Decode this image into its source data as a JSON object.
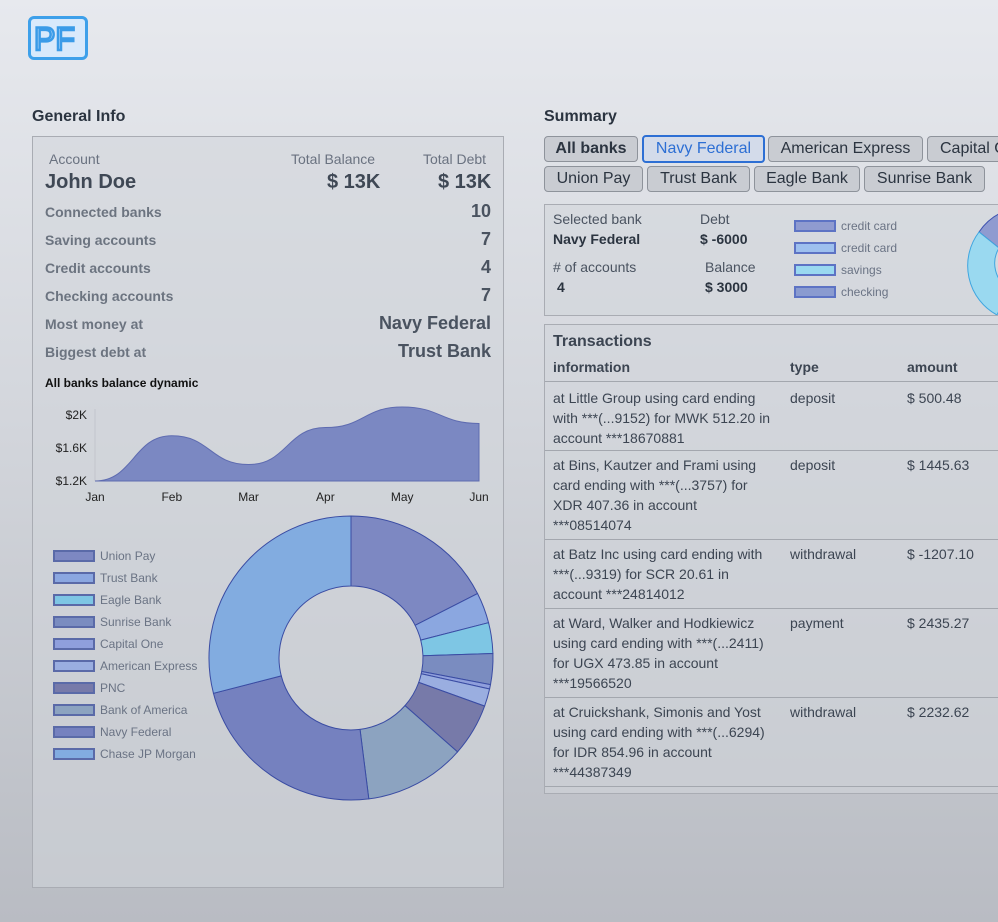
{
  "logo": {
    "text": "PF"
  },
  "general_info": {
    "title": "General Info",
    "account_header": "Account",
    "total_balance_header": "Total Balance",
    "total_debt_header": "Total Debt",
    "account_name": "John Doe",
    "total_balance": "$ 13K",
    "total_debt": "$ 13K",
    "rows": [
      {
        "label": "Connected banks",
        "value": "10"
      },
      {
        "label": "Saving accounts",
        "value": "7"
      },
      {
        "label": "Credit accounts",
        "value": "4"
      },
      {
        "label": "Checking accounts",
        "value": "7"
      },
      {
        "label": "Most money at",
        "value": "Navy Federal"
      },
      {
        "label": "Biggest debt at",
        "value": "Trust Bank"
      }
    ]
  },
  "chart_data": [
    {
      "type": "area",
      "title": "All banks balance dynamic",
      "categories": [
        "Jan",
        "Feb",
        "Mar",
        "Apr",
        "May",
        "Jun"
      ],
      "values": [
        1200,
        1750,
        1400,
        1850,
        2100,
        1900
      ],
      "y_tick_labels": [
        "$2K",
        "$1.6K",
        "$1.2K"
      ],
      "ylim": [
        1200,
        2100
      ],
      "color": "#7b88c2"
    },
    {
      "type": "pie",
      "variant": "donut",
      "categories": [
        "Union Pay",
        "Trust Bank",
        "Eagle Bank",
        "Sunrise Bank",
        "Capital One",
        "American Express",
        "PNC",
        "Bank of America",
        "Navy Federal",
        "Chase JP Morgan"
      ],
      "values": [
        17.5,
        3.5,
        3.5,
        3.5,
        0.5,
        2.0,
        6.0,
        11.5,
        23.0,
        29.0
      ],
      "colors": [
        "#7d88c2",
        "#8ba7e0",
        "#7ec6e4",
        "#7a8cc0",
        "#8f9fdc",
        "#9aaee0",
        "#777aa9",
        "#8ca3c0",
        "#7581bf",
        "#82ace0"
      ],
      "legend_position": "left"
    }
  ],
  "summary": {
    "title": "Summary",
    "tabs_row1": [
      "All banks",
      "Navy Federal",
      "American Express",
      "Capital One"
    ],
    "tabs_row2": [
      "Union Pay",
      "Trust Bank",
      "Eagle Bank",
      "Sunrise Bank"
    ],
    "selected_bank_label": "Selected bank",
    "selected_bank": "Navy Federal",
    "debt_label": "Debt",
    "debt": "$ -6000",
    "accounts_label": "# of accounts",
    "accounts": "4",
    "balance_label": "Balance",
    "balance": "$ 3000",
    "legend": [
      {
        "label": "credit card",
        "color": "#8f9bd0"
      },
      {
        "label": "credit card",
        "color": "#9ec0ee"
      },
      {
        "label": "savings",
        "color": "#9ad9f0"
      },
      {
        "label": "checking",
        "color": "#8a9bd0"
      }
    ]
  },
  "transactions": {
    "title": "Transactions",
    "headers": [
      "information",
      "type",
      "amount"
    ],
    "rows": [
      {
        "info": [
          "at Little Group using card ending",
          "with ***(...9152) for MWK 512.20 in",
          "account ***18670881"
        ],
        "type": "deposit",
        "amount": "$ 500.48"
      },
      {
        "info": [
          "at Bins, Kautzer and Frami using",
          "card ending with ***(...3757) for",
          "XDR 407.36 in account",
          "***08514074"
        ],
        "type": "deposit",
        "amount": "$ 1445.63"
      },
      {
        "info": [
          "at Batz Inc using card ending with",
          "***(...9319) for SCR 20.61 in",
          "account ***24814012"
        ],
        "type": "withdrawal",
        "amount": "$ -1207.10"
      },
      {
        "info": [
          "at Ward, Walker and Hodkiewicz",
          "using card ending with ***(...2411)",
          "for UGX 473.85 in account",
          "***19566520"
        ],
        "type": "payment",
        "amount": "$ 2435.27"
      },
      {
        "info": [
          "at Cruickshank, Simonis and Yost",
          "using card ending with ***(...6294)",
          "for IDR 854.96 in account",
          "***44387349"
        ],
        "type": "withdrawal",
        "amount": "$ 2232.62"
      }
    ]
  }
}
